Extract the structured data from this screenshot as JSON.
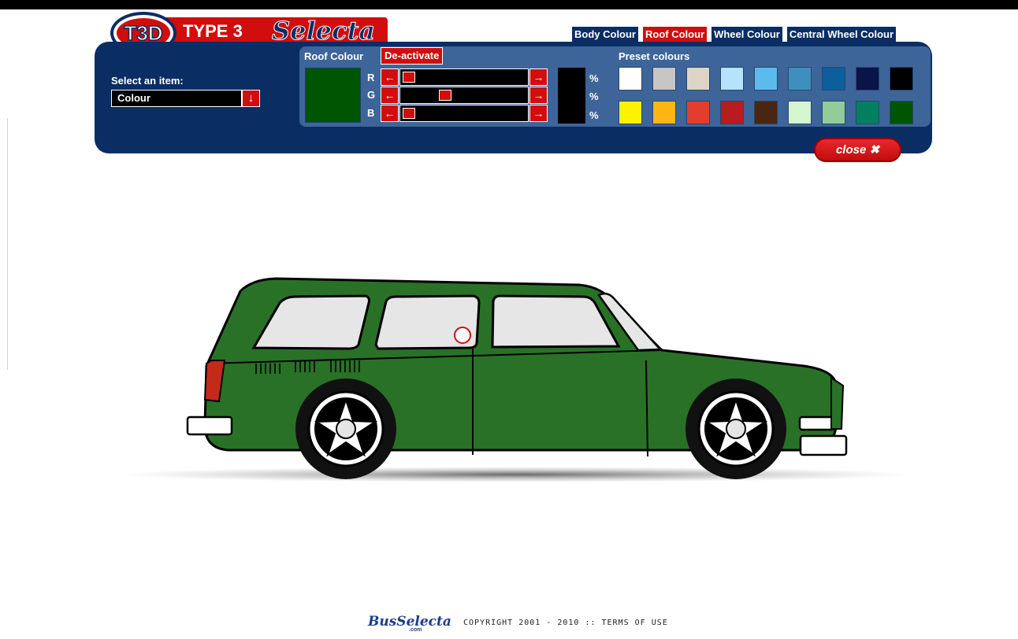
{
  "logo": {
    "badge": "T3D",
    "type": "TYPE 3",
    "brand": "Selecta"
  },
  "tabs": [
    {
      "label": "Body Colour",
      "active": false
    },
    {
      "label": "Roof Colour",
      "active": true
    },
    {
      "label": "Wheel Colour",
      "active": false
    },
    {
      "label": "Central Wheel Colour",
      "active": false
    }
  ],
  "selector": {
    "label": "Select an item:",
    "value": "Colour",
    "arrow": "↓"
  },
  "roof": {
    "title": "Roof Colour",
    "deactivate_label": "De-activate",
    "current_color": "#005500",
    "channels": [
      {
        "label": "R",
        "level": 0.0,
        "pct_symbol": "%"
      },
      {
        "label": "G",
        "level": 0.33,
        "pct_symbol": "%"
      },
      {
        "label": "B",
        "level": 0.0,
        "pct_symbol": "%"
      }
    ],
    "left_arrow": "←",
    "right_arrow": "→"
  },
  "presets": {
    "title": "Preset colours",
    "row1": [
      "#ffffff",
      "#c6c6c6",
      "#ddd5c3",
      "#b4e3fa",
      "#5bbcec",
      "#3e8fbe",
      "#0b5f9c",
      "#0a1449",
      "#000000"
    ],
    "row2": [
      "#fff200",
      "#ffb612",
      "#e33d2d",
      "#b71c1f",
      "#4a2512",
      "#d3f5cf",
      "#93cc99",
      "#00805f",
      "#005500"
    ]
  },
  "close_label": "close",
  "car": {
    "body_color": "#297127",
    "window_color": "#e6e6e6"
  },
  "footer": {
    "brand": "BusSelecta",
    "brand_sub": ".com",
    "copyright": "COPYRIGHT 2001 - 2010 :: TERMS OF USE"
  }
}
